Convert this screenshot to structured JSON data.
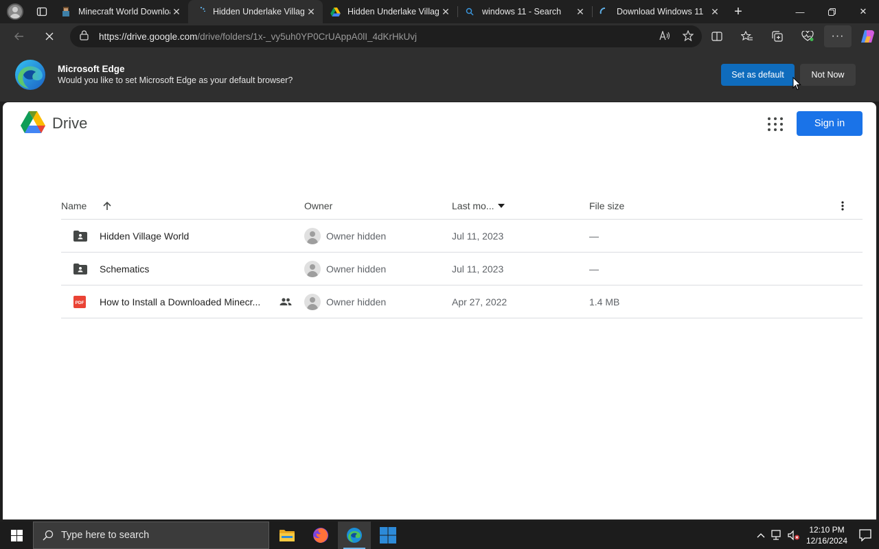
{
  "tabs": [
    {
      "title": "Minecraft World Downloa",
      "favicon": "minecraft-icon",
      "active": false
    },
    {
      "title": "Hidden Underlake Village",
      "favicon": "loading-spinner-icon",
      "active": true
    },
    {
      "title": "Hidden Underlake Village",
      "favicon": "google-drive-icon",
      "active": false
    },
    {
      "title": "windows 11 - Search",
      "favicon": "search-icon",
      "active": false
    },
    {
      "title": "Download Windows 11",
      "favicon": "loading-spinner-icon",
      "active": false
    }
  ],
  "address": {
    "host": "https://drive.google.com",
    "path": "/drive/folders/1x-_vy5uh0YP0CrUAppA0lI_4dKrHkUvj"
  },
  "infobar": {
    "title": "Microsoft Edge",
    "message": "Would you like to set Microsoft Edge as your default browser?",
    "set_default_label": "Set as default",
    "not_now_label": "Not Now"
  },
  "drive": {
    "product_name": "Drive",
    "sign_in_label": "Sign in",
    "columns": {
      "name": "Name",
      "owner": "Owner",
      "last_modified": "Last mo...",
      "file_size": "File size"
    },
    "rows": [
      {
        "icon": "shared-folder-icon",
        "name": "Hidden Village World",
        "shared": false,
        "owner": "Owner hidden",
        "date": "Jul 11, 2023",
        "size": "—"
      },
      {
        "icon": "shared-folder-icon",
        "name": "Schematics",
        "shared": false,
        "owner": "Owner hidden",
        "date": "Jul 11, 2023",
        "size": "—"
      },
      {
        "icon": "pdf-icon",
        "name": "How to Install a Downloaded Minecr...",
        "shared": true,
        "owner": "Owner hidden",
        "date": "Apr 27, 2022",
        "size": "1.4 MB"
      }
    ]
  },
  "taskbar": {
    "search_placeholder": "Type here to search",
    "time": "12:10 PM",
    "date": "12/16/2024"
  },
  "colors": {
    "edge_blue": "#0f6cbd",
    "drive_blue": "#1a73e8"
  }
}
